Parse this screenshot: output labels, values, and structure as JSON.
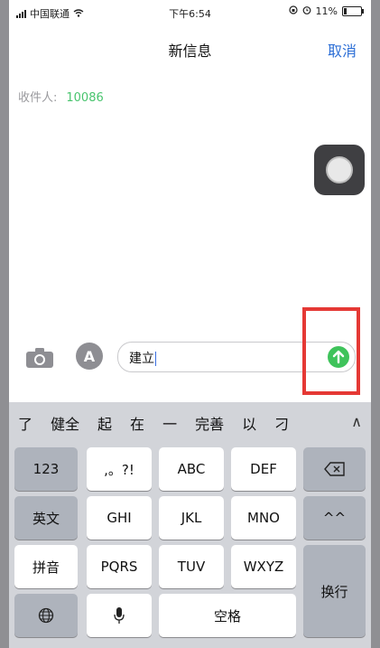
{
  "status_bar": {
    "carrier": "中国联通",
    "time": "下午6:54",
    "battery": "11%"
  },
  "nav": {
    "title": "新信息",
    "cancel": "取消"
  },
  "recipient": {
    "label": "收件人:",
    "number": "10086"
  },
  "message": {
    "text": "建立"
  },
  "candidates": [
    "了",
    "健全",
    "起",
    "在",
    "一",
    "完善",
    "以",
    "刁"
  ],
  "keyboard": {
    "row1": [
      "123",
      ",。?!",
      "ABC",
      "DEF"
    ],
    "row2": [
      "英文",
      "GHI",
      "JKL",
      "MNO",
      "^^"
    ],
    "row3": [
      "拼音",
      "PQRS",
      "TUV",
      "WXYZ"
    ],
    "enter": "换行",
    "space": "空格"
  }
}
